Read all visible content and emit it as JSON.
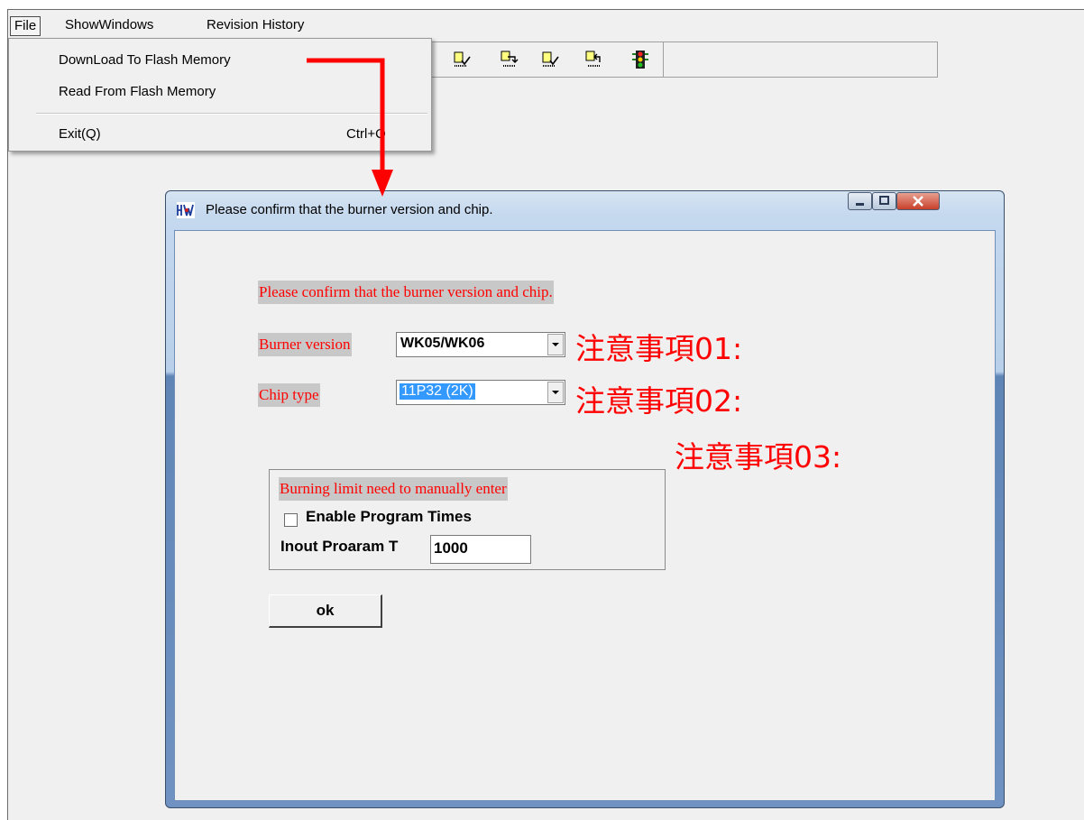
{
  "menubar": {
    "file": "File",
    "show_windows": "ShowWindows",
    "revision_history": "Revision History"
  },
  "file_menu": {
    "download": "DownLoad To Flash Memory",
    "read": "Read From Flash Memory",
    "exit": "Exit(Q)",
    "exit_shortcut": "Ctrl+Q"
  },
  "toolbar": {
    "icons": [
      "chip-check-icon",
      "chip-download-icon",
      "chip-verify-icon",
      "chip-read-icon",
      "traffic-light-icon"
    ]
  },
  "dialog": {
    "title": "Please confirm that the burner version and chip.",
    "heading": "Please confirm that the burner version and chip.",
    "burner_label": "Burner version",
    "burner_value": "WK05/WK06",
    "chip_label": "Chip type",
    "chip_value": "11P32  (2K)",
    "group_heading": "Burning limit need to manually enter",
    "enable_checkbox_label": "Enable Program Times",
    "enable_checked": false,
    "input_label": "Inout Proaram T",
    "input_value": "1000",
    "ok_label": "ok"
  },
  "annotations": {
    "note1": "注意事項01:",
    "note2": "注意事項02:",
    "note3": "注意事項03:"
  },
  "colors": {
    "annotation_red": "#ff0000",
    "selection_blue": "#3399ff"
  }
}
